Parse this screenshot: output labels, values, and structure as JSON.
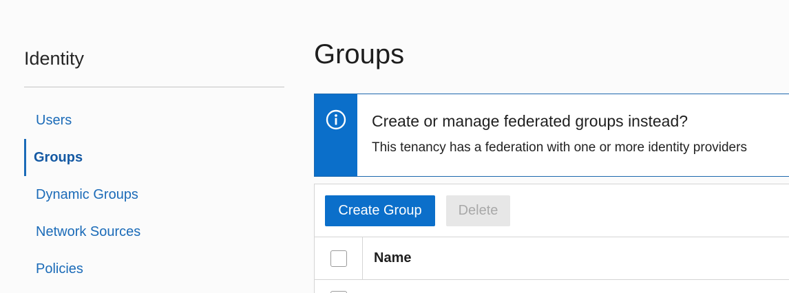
{
  "sidebar": {
    "title": "Identity",
    "items": [
      {
        "label": "Users",
        "active": false
      },
      {
        "label": "Groups",
        "active": true
      },
      {
        "label": "Dynamic Groups",
        "active": false
      },
      {
        "label": "Network Sources",
        "active": false
      },
      {
        "label": "Policies",
        "active": false
      }
    ]
  },
  "main": {
    "title": "Groups",
    "banner": {
      "icon": "info-icon",
      "heading": "Create or manage federated groups instead?",
      "text": "This tenancy has a federation with one or more identity providers"
    },
    "toolbar": {
      "create_label": "Create Group",
      "delete_label": "Delete"
    },
    "table": {
      "columns": [
        "Name"
      ]
    }
  },
  "colors": {
    "accent": "#0b6fca",
    "link": "#1b6bb8",
    "disabled_bg": "#e7e7e7",
    "disabled_text": "#a8a8a8"
  }
}
